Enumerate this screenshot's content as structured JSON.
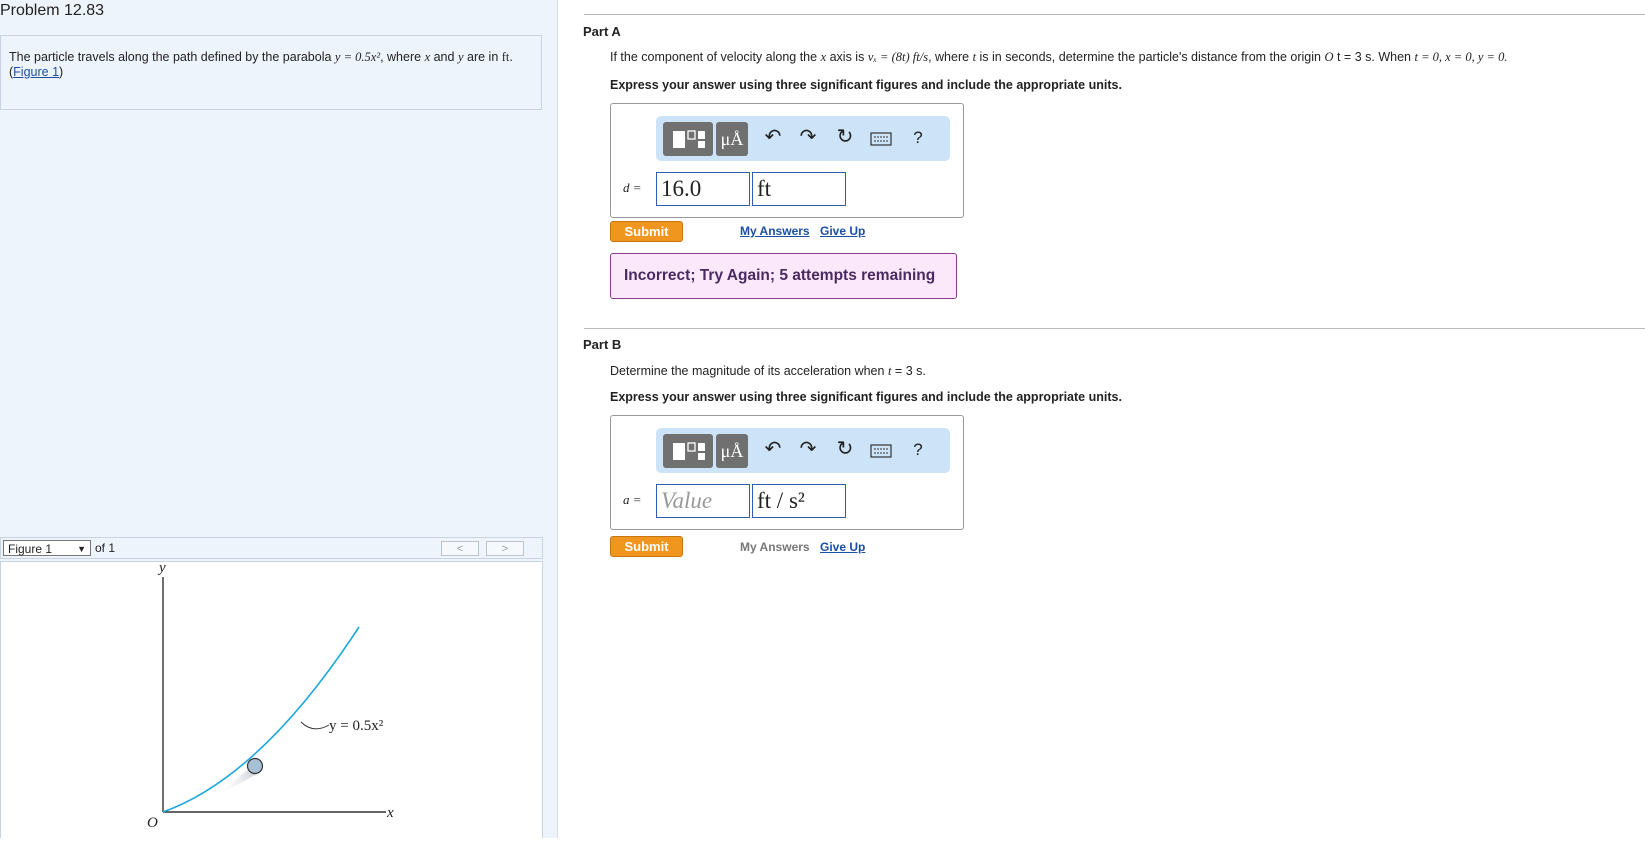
{
  "problem": {
    "title": "Problem 12.83",
    "text_prefix": "The particle travels along the path defined by the parabola",
    "equation": "y = 0.5x²",
    "text_mid": ", where",
    "var_x": "x",
    "text_and": "and",
    "var_y": "y",
    "text_are": "are in",
    "unit": "ft",
    "figure_link": "Figure 1"
  },
  "figure_nav": {
    "select_value": "Figure 1",
    "of_label": "of 1",
    "prev": "<",
    "next": ">"
  },
  "figure": {
    "y_axis": "y",
    "x_axis": "x",
    "origin": "O",
    "curve_label": "y = 0.5x²"
  },
  "partA": {
    "title": "Part A",
    "question_1": "If the component of velocity along the",
    "question_var_x": "x",
    "question_2": "axis is",
    "question_eq": "vₓ = (8t) ft/s",
    "question_3": ", where",
    "question_var_t": "t",
    "question_4": "is in seconds, determine the particle's distance from the origin",
    "question_O": "O",
    "question_5": "t = 3 s. When",
    "question_init": "t = 0, x = 0, y = 0.",
    "instruction": "Express your answer using three significant figures and include the appropriate units.",
    "var_label": "d =",
    "value": "16.0",
    "unit": "ft",
    "submit": "Submit",
    "my_answers": "My Answers",
    "give_up": "Give Up",
    "feedback": "Incorrect; Try Again; 5 attempts remaining"
  },
  "partB": {
    "title": "Part B",
    "question": "Determine the magnitude of its acceleration when",
    "question_var": "t",
    "question_end": "= 3 s.",
    "instruction": "Express your answer using three significant figures and include the appropriate units.",
    "var_label": "a =",
    "placeholder": "Value",
    "unit": "ft / s²",
    "submit": "Submit",
    "my_answers": "My Answers",
    "give_up": "Give Up"
  },
  "toolbar": {
    "units_label": "μÅ",
    "help": "?"
  },
  "colors": {
    "submit": "#f0961f",
    "link": "#1a4fa3",
    "feedback_bg": "#fbe9fb",
    "toolbar_bg": "#cde3f8",
    "curve": "#1aa7d9"
  }
}
